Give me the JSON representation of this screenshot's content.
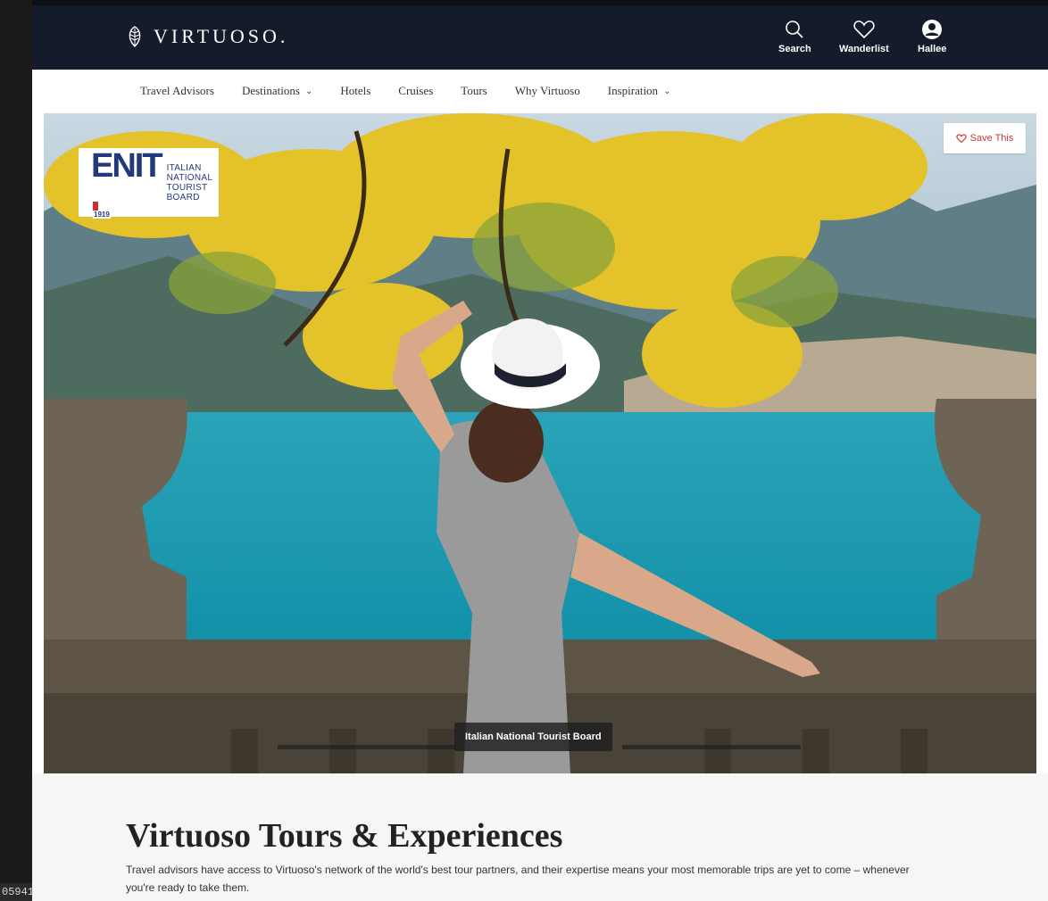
{
  "frame_id": "05941",
  "header": {
    "logo_text": "VIRTUOSO.",
    "search_label": "Search",
    "wanderlist_label": "Wanderlist",
    "user_label": "Hallee"
  },
  "nav": {
    "items": [
      {
        "label": "Travel Advisors"
      },
      {
        "label": "Destinations"
      },
      {
        "label": "Hotels"
      },
      {
        "label": "Cruises"
      },
      {
        "label": "Tours"
      },
      {
        "label": "Why Virtuoso"
      },
      {
        "label": "Inspiration"
      }
    ]
  },
  "hero": {
    "badge": {
      "letters": "ENIT",
      "year": "1919",
      "name_lines": [
        "ITALIAN",
        "NATIONAL",
        "TOURIST BOARD"
      ]
    },
    "save_label": "Save This",
    "caption": "Italian National Tourist Board"
  },
  "main": {
    "title": "Virtuoso Tours & Experiences",
    "description": "Travel advisors have access to Virtuoso's network of the world's best tour partners, and their expertise means your most memorable trips are yet to come – whenever you're ready to take them."
  },
  "colors": {
    "header_bg": "#141b2b",
    "save_accent": "#c93a3a",
    "badge_blue": "#233a7a"
  }
}
